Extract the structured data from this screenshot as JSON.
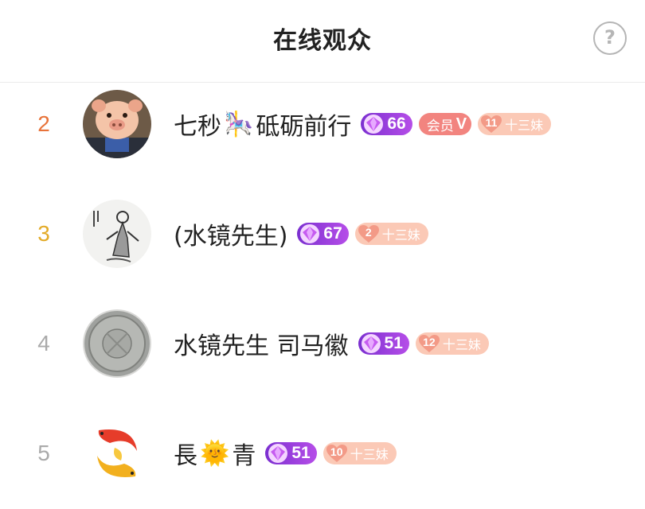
{
  "header": {
    "title": "在线观众",
    "help_icon_glyph": "?"
  },
  "colors": {
    "rank_2": "#e8733a",
    "rank_3": "#e3ab28",
    "rank_other": "#aaaaaa",
    "level_badge": "#8a35d8",
    "vip_badge": "#f2847f",
    "fan_badge": "#fbc9b6"
  },
  "viewers": [
    {
      "rank": "2",
      "name_a": "七秒",
      "emoji": "🎠",
      "name_b": "砥砺前行",
      "level": "66",
      "vip_label": "会员",
      "vip_mark": "V",
      "fan_level": "11",
      "fan_name": "十三妹",
      "avatar_icon": "pig-avatar"
    },
    {
      "rank": "3",
      "name_a": "(水镜先生)",
      "level": "67",
      "fan_level": "2",
      "fan_name": "十三妹",
      "avatar_icon": "ink-figure-avatar"
    },
    {
      "rank": "4",
      "name_a": "水镜先生 司马徽",
      "level": "51",
      "fan_level": "12",
      "fan_name": "十三妹",
      "avatar_icon": "coin-avatar"
    },
    {
      "rank": "5",
      "name_a": "長",
      "emoji": "🌞",
      "name_b": "青",
      "level": "51",
      "fan_level": "10",
      "fan_name": "十三妹",
      "avatar_icon": "koi-avatar"
    }
  ]
}
